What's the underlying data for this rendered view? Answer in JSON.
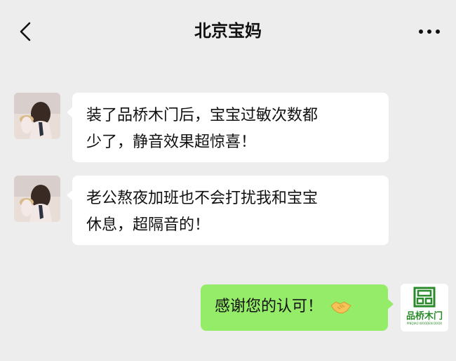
{
  "header": {
    "title": "北京宝妈",
    "back_icon": "chevron-left-icon",
    "more_icon": "more-dots-icon"
  },
  "messages": [
    {
      "side": "left",
      "text_lines": [
        "装了品桥木门后，宝宝过敏次数都",
        "少了，静音效果超惊喜！"
      ],
      "avatar": "woman-portrait"
    },
    {
      "side": "left",
      "text_lines": [
        "老公熬夜加班也不会打扰我和宝宝",
        "休息，超隔音的！"
      ],
      "avatar": "woman-portrait"
    },
    {
      "side": "right",
      "text": "感谢您的认可！",
      "emoji": "handshake-icon",
      "avatar": "brand-logo"
    }
  ],
  "brand": {
    "name": "品桥木门",
    "sub": "PINQIAO WOODEN DOOR",
    "color": "#2b8a2b"
  },
  "colors": {
    "background": "#ededed",
    "bubble_left": "#ffffff",
    "bubble_right": "#95ec69"
  }
}
